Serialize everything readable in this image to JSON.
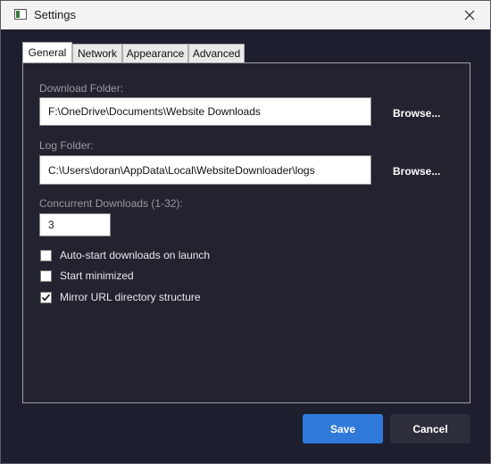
{
  "window": {
    "title": "Settings"
  },
  "tabs": [
    {
      "label": "General",
      "active": true
    },
    {
      "label": "Network",
      "active": false
    },
    {
      "label": "Appearance",
      "active": false
    },
    {
      "label": "Advanced",
      "active": false
    }
  ],
  "general": {
    "download_folder": {
      "label": "Download Folder:",
      "value": "F:\\OneDrive\\Documents\\Website Downloads",
      "browse_label": "Browse..."
    },
    "log_folder": {
      "label": "Log Folder:",
      "value": "C:\\Users\\doran\\AppData\\Local\\WebsiteDownloader\\logs",
      "browse_label": "Browse..."
    },
    "concurrent": {
      "label": "Concurrent Downloads (1-32):",
      "value": "3"
    },
    "options": [
      {
        "label": "Auto-start downloads on launch",
        "checked": false
      },
      {
        "label": "Start minimized",
        "checked": false
      },
      {
        "label": "Mirror URL directory structure",
        "checked": true
      }
    ]
  },
  "footer": {
    "save_label": "Save",
    "cancel_label": "Cancel"
  },
  "colors": {
    "accent": "#2f7ad9",
    "background": "#1e1f2e",
    "panel": "#22232f"
  },
  "icons": {
    "app": "window-app-icon",
    "close": "close-icon",
    "check": "checkmark-icon"
  }
}
